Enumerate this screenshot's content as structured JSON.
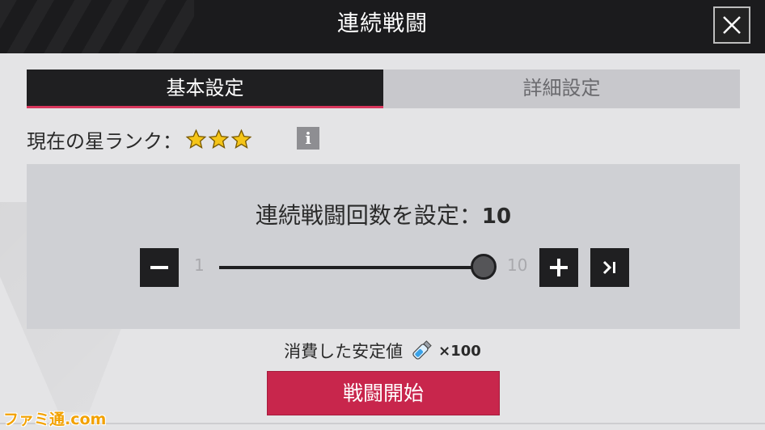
{
  "window": {
    "title": "連続戦闘"
  },
  "tabs": [
    {
      "label": "基本設定",
      "active": true
    },
    {
      "label": "詳細設定",
      "active": false
    }
  ],
  "rank": {
    "label": "現在の星ランク：",
    "stars": 3,
    "star_color": "#f5c518"
  },
  "battle_count": {
    "label": "連続戦闘回数を設定：",
    "value": "10"
  },
  "slider": {
    "min_label": "1",
    "max_label": "10",
    "value": 10,
    "min": 1,
    "max": 10
  },
  "cost": {
    "label": "消費した安定値",
    "amount": "×100"
  },
  "start_button": {
    "label": "戦闘開始",
    "color": "#c8264c"
  },
  "watermark": {
    "text": "ファミ通.com"
  },
  "colors": {
    "accent": "#d8365c",
    "dark": "#1f1f21"
  }
}
